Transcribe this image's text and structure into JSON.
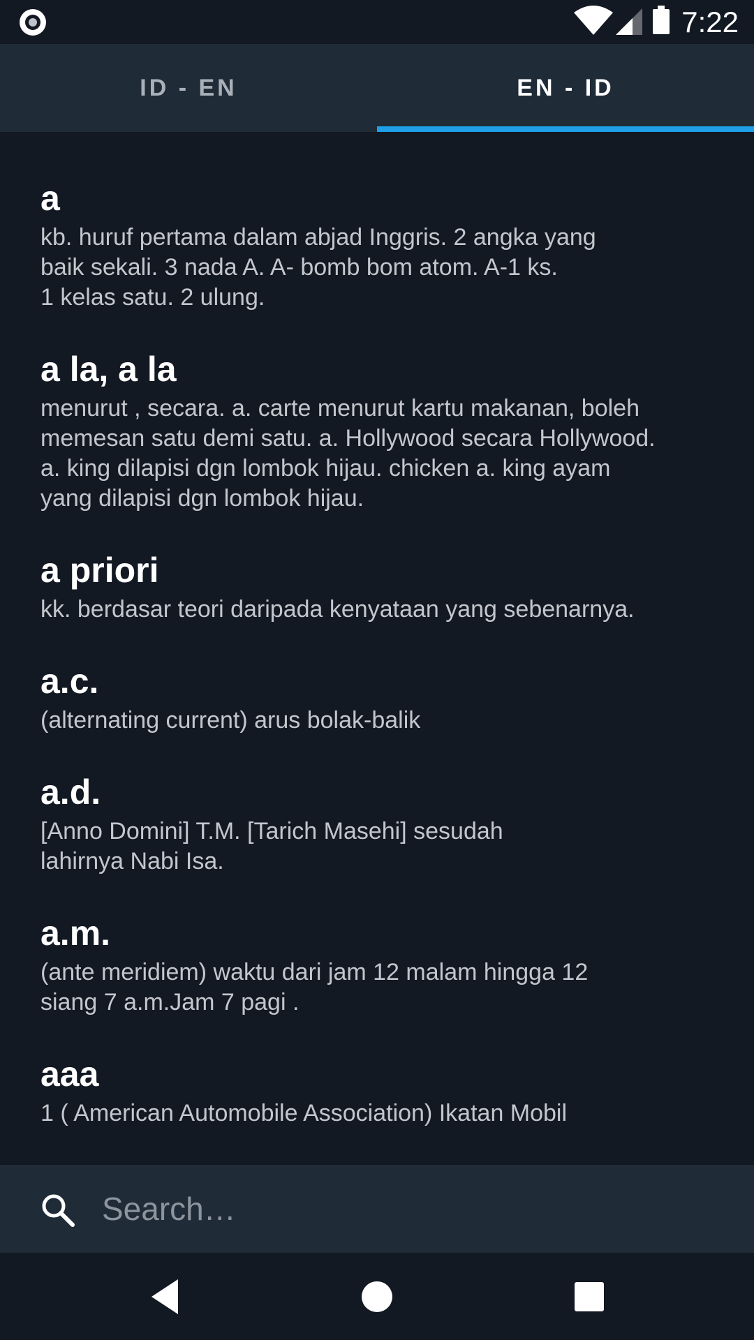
{
  "status_bar": {
    "time": "7:22",
    "icons": [
      "camera-icon",
      "wifi-icon",
      "signal-icon",
      "battery-icon"
    ]
  },
  "tabs": [
    {
      "label": "ID - EN",
      "selected": false
    },
    {
      "label": "EN - ID",
      "selected": true
    }
  ],
  "entries": [
    {
      "term": "a",
      "definition": "kb. huruf pertama dalam abjad Inggris. 2 angka yang\nbaik sekali. 3 nada  A.   A- bomb bom atom.  A-1 ks.\n1 kelas satu. 2 ulung."
    },
    {
      "term": "a la, a la",
      "definition": "menurut , secara. a. carte menurut kartu makanan, boleh\nmemesan satu demi satu. a. Hollywood secara Hollywood.\na. king dilapisi dgn lombok hijau. chicken a. king ayam\nyang dilapisi dgn lombok hijau."
    },
    {
      "term": "a priori",
      "definition": "kk. berdasar teori daripada kenyataan yang sebenarnya."
    },
    {
      "term": "a.c.",
      "definition": "(alternating current) arus bolak-balik"
    },
    {
      "term": "a.d.",
      "definition": "[Anno Domini] T.M. [Tarich Masehi] sesudah\nlahirnya Nabi Isa."
    },
    {
      "term": "a.m.",
      "definition": "(ante meridiem) waktu dari jam 12 malam hingga 12\nsiang 7 a.m.Jam 7 pagi ."
    },
    {
      "term": "aaa",
      "definition": "1 ( American Automobile Association)  Ikatan Mobil"
    }
  ],
  "search": {
    "placeholder": "Search…",
    "value": ""
  },
  "colors": {
    "background": "#131923",
    "bar": "#202b38",
    "accent": "#1e9fe8",
    "definition_text": "#c3c7cd"
  },
  "nav_bar": [
    "back-icon",
    "home-icon",
    "recents-icon"
  ]
}
